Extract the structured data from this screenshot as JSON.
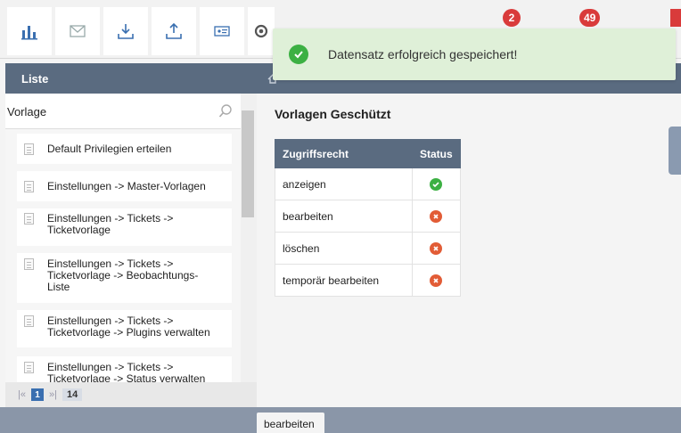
{
  "toolbar": {
    "buttons": [
      {
        "icon": "bar-chart-icon"
      },
      {
        "icon": "mail-icon"
      },
      {
        "icon": "download-icon"
      },
      {
        "icon": "upload-icon"
      },
      {
        "icon": "id-card-icon"
      },
      {
        "icon": "gear-icon"
      }
    ],
    "badges": [
      "2",
      "49"
    ]
  },
  "toast": {
    "message": "Datensatz erfolgreich gespeichert!"
  },
  "left_panel": {
    "title": "Liste",
    "search_value": "Vorlage",
    "items": [
      {
        "label": "Default Privilegien erteilen"
      },
      {
        "label": "Einstellungen -> Master-Vorlagen"
      },
      {
        "label": "Einstellungen -> Tickets -> Ticketvorlage"
      },
      {
        "label": "Einstellungen -> Tickets -> Ticketvorlage -> Beobachtungs-Liste"
      },
      {
        "label": "Einstellungen -> Tickets -> Ticketvorlage -> Plugins verwalten"
      },
      {
        "label": "Einstellungen -> Tickets -> Ticketvorlage -> Status verwalten"
      }
    ],
    "pager": {
      "current": "1",
      "total": "14"
    }
  },
  "main": {
    "title": "Vorlagen Geschützt",
    "table": {
      "headers": [
        "Zugriffsrecht",
        "Status"
      ],
      "rows": [
        {
          "right": "anzeigen",
          "status": "allowed"
        },
        {
          "right": "bearbeiten",
          "status": "denied"
        },
        {
          "right": "löschen",
          "status": "denied"
        },
        {
          "right": "temporär bearbeiten",
          "status": "denied"
        }
      ]
    }
  },
  "bottom_tab": "bearbeiten",
  "colors": {
    "accent": "#5a6b80",
    "success": "#3cb043",
    "danger": "#e25c36",
    "toast_bg": "#dff0d8"
  }
}
